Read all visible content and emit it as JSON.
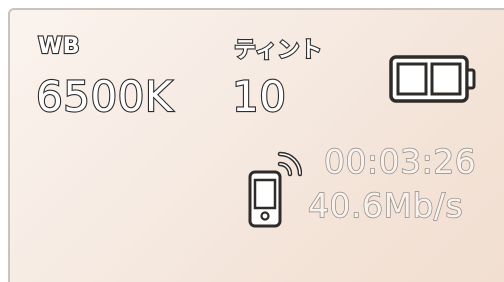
{
  "white_balance": {
    "label": "WB",
    "value": "6500K"
  },
  "tint": {
    "label": "ティント",
    "value": "10"
  },
  "battery": {
    "icon": "battery-icon",
    "level_fraction": 1.0
  },
  "recording": {
    "icon": "phone-wireless-icon",
    "timecode": "00:03:26",
    "bitrate": "40.6Mb/s"
  },
  "colors": {
    "background": "#f6ebe3",
    "outline": "#2f2b29",
    "secondary_outline": "#8f8884"
  }
}
